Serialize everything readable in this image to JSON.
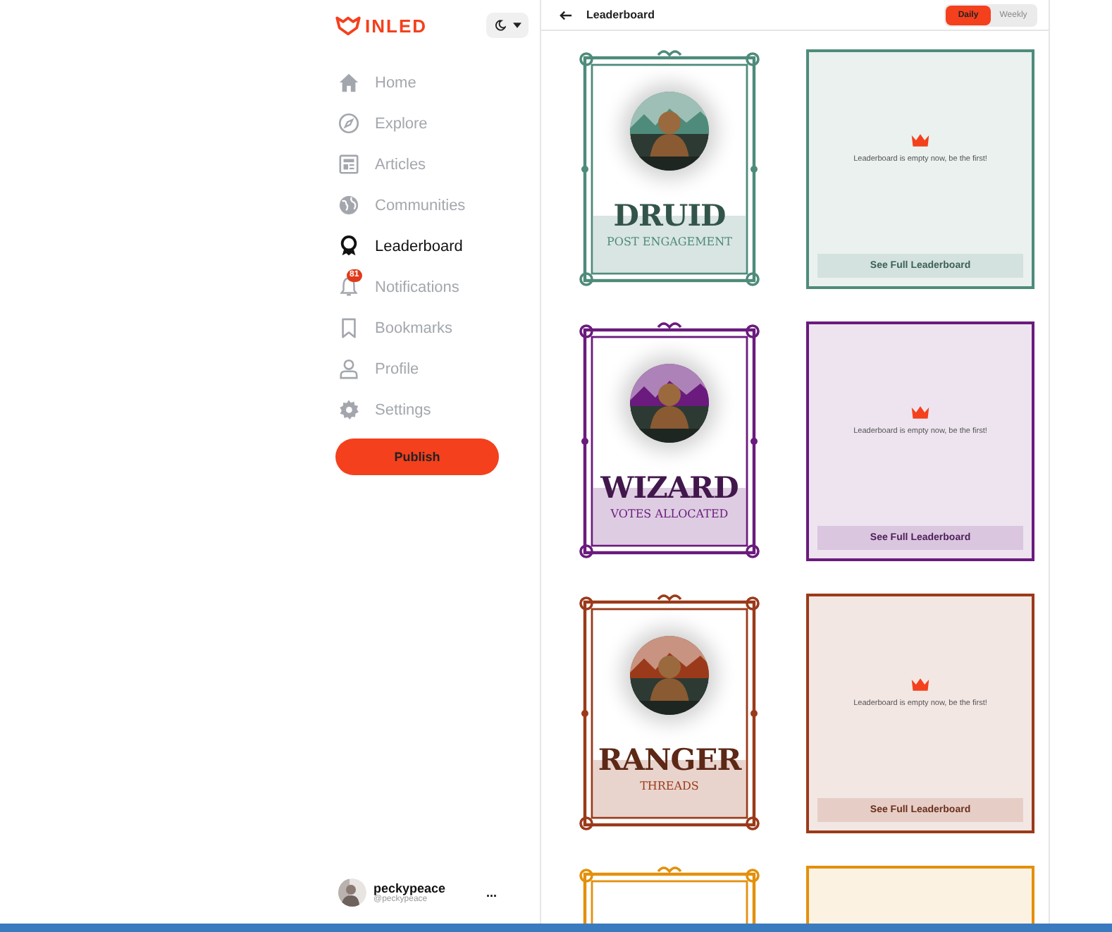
{
  "logo": "INLED",
  "theme_toggle": {
    "dark": false
  },
  "nav": [
    {
      "label": "Home",
      "selected": false
    },
    {
      "label": "Explore",
      "selected": false
    },
    {
      "label": "Articles",
      "selected": false
    },
    {
      "label": "Communities",
      "selected": false
    },
    {
      "label": "Leaderboard",
      "selected": true
    },
    {
      "label": "Notifications",
      "selected": false,
      "badge": "81"
    },
    {
      "label": "Bookmarks",
      "selected": false
    },
    {
      "label": "Profile",
      "selected": false
    },
    {
      "label": "Settings",
      "selected": false
    }
  ],
  "publish": "Publish",
  "user": {
    "name": "peckypeace",
    "handle": "@peckypeace",
    "more": "..."
  },
  "header": {
    "title": "Leaderboard",
    "periods": [
      {
        "label": "Daily",
        "selected": true
      },
      {
        "label": "Weekly",
        "selected": false
      }
    ]
  },
  "boards": [
    {
      "color": "#4e8b7a",
      "title": "DRUID",
      "subtitle": "POST ENGAGEMENT",
      "message": "Leaderboard is empty now, be the first!",
      "button": "See Full Leaderboard"
    },
    {
      "color": "#6a1b7d",
      "title": "WIZARD",
      "subtitle": "VOTES ALLOCATED",
      "message": "Leaderboard is empty now, be the first!",
      "button": "See Full Leaderboard"
    },
    {
      "color": "#9b3a1a",
      "title": "RANGER",
      "subtitle": "THREADS",
      "message": "Leaderboard is empty now, be the first!",
      "button": "See Full Leaderboard"
    },
    {
      "color": "#e3900c"
    }
  ]
}
